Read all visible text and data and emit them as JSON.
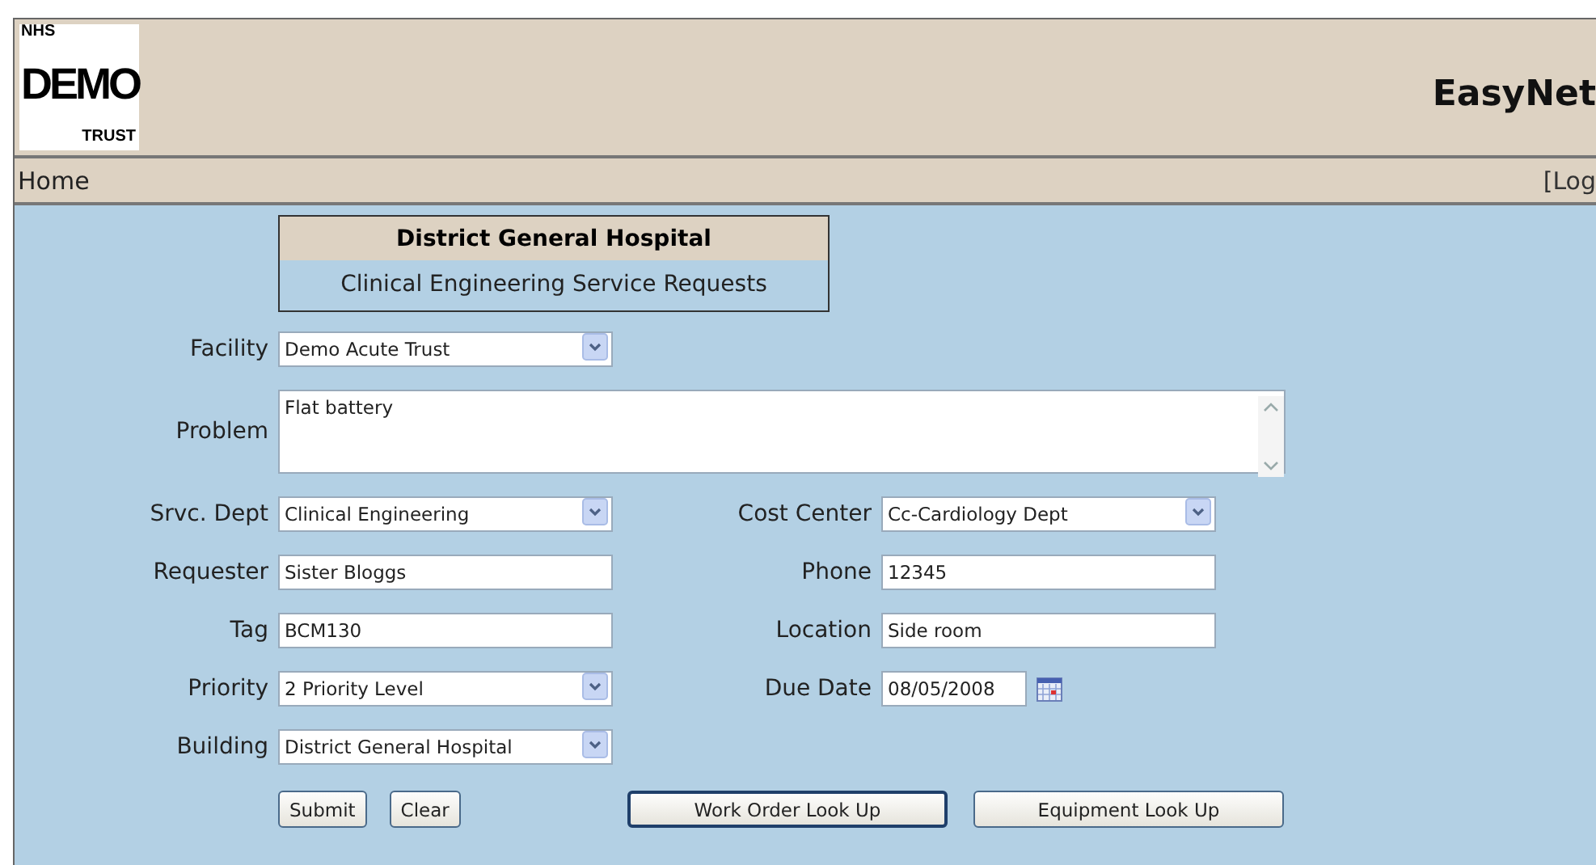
{
  "logo": {
    "top": "NHS",
    "main": "DEMO",
    "bottom": "TRUST"
  },
  "app_title": "EasyNet",
  "nav": {
    "home": "Home",
    "logout": "[Log"
  },
  "form_header": {
    "title": "District General Hospital",
    "subtitle": "Clinical Engineering Service Requests"
  },
  "rows": [
    [
      {
        "label": "Facility",
        "kind": "select",
        "value": "Demo Acute Trust"
      }
    ],
    [
      {
        "label": "Problem",
        "kind": "textarea",
        "value": "Flat battery"
      }
    ],
    [
      {
        "label": "Srvc. Dept",
        "kind": "select",
        "value": "Clinical Engineering"
      },
      {
        "label": "Cost Center",
        "kind": "select",
        "value": "Cc-Cardiology Dept"
      }
    ],
    [
      {
        "label": "Requester",
        "kind": "text",
        "value": "Sister Bloggs"
      },
      {
        "label": "Phone",
        "kind": "text",
        "value": "12345"
      }
    ],
    [
      {
        "label": "Tag",
        "kind": "text",
        "value": "BCM130"
      },
      {
        "label": "Location",
        "kind": "text",
        "value": "Side room"
      }
    ],
    [
      {
        "label": "Priority",
        "kind": "select",
        "value": "2 Priority Level"
      },
      {
        "label": "Due Date",
        "kind": "date",
        "value": "08/05/2008"
      }
    ],
    [
      {
        "label": "Building",
        "kind": "select",
        "value": "District General Hospital"
      }
    ]
  ],
  "buttons": {
    "left": [
      {
        "label": "Submit",
        "focused": false
      },
      {
        "label": "Clear",
        "focused": false
      }
    ],
    "right": [
      {
        "label": "Work Order Look Up",
        "focused": true
      },
      {
        "label": "Equipment Look Up",
        "focused": false
      }
    ]
  }
}
